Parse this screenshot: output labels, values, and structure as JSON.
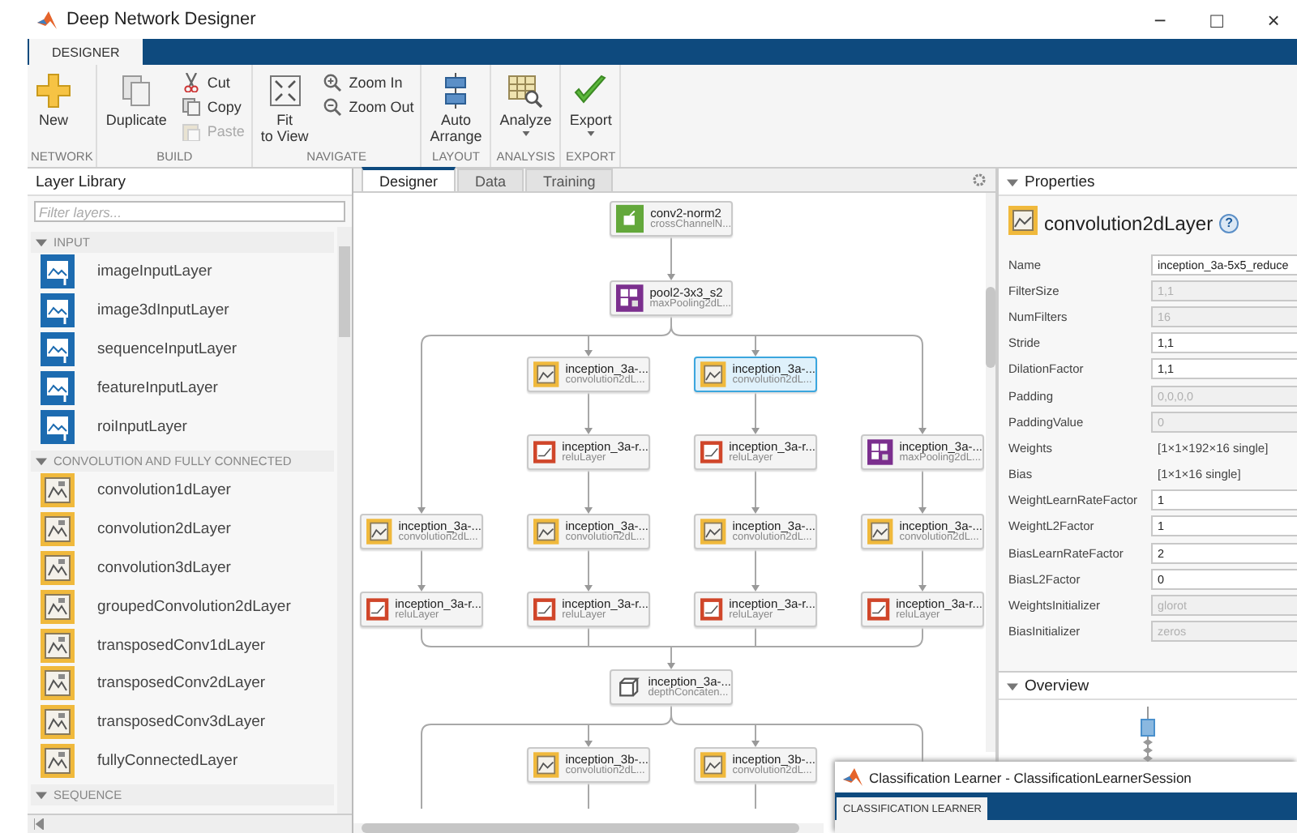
{
  "window": {
    "title": "Deep Network Designer",
    "controls": [
      "−",
      "□",
      "×"
    ]
  },
  "ribbon_tabs": [
    {
      "label": "DESIGNER",
      "selected": true
    }
  ],
  "toolstrip": [
    {
      "label": "NETWORK",
      "items": [
        {
          "kind": "large",
          "label": "New",
          "disabled": false,
          "dropdown": false
        }
      ]
    },
    {
      "label": "BUILD",
      "items": [
        {
          "kind": "large",
          "label": "Duplicate",
          "disabled": false,
          "dropdown": false
        },
        {
          "kind": "small",
          "label": "Cut",
          "disabled": false,
          "dropdown": false
        },
        {
          "kind": "small",
          "label": "Copy",
          "disabled": false,
          "dropdown": false
        },
        {
          "kind": "small",
          "label": "Paste",
          "disabled": true,
          "dropdown": false
        }
      ]
    },
    {
      "label": "NAVIGATE",
      "items": [
        {
          "kind": "large",
          "label": "Fit\nto View",
          "disabled": false,
          "dropdown": false
        },
        {
          "kind": "small",
          "label": "Zoom In",
          "disabled": false,
          "dropdown": false
        },
        {
          "kind": "small",
          "label": "Zoom Out",
          "disabled": false,
          "dropdown": false
        }
      ]
    },
    {
      "label": "LAYOUT",
      "items": [
        {
          "kind": "large",
          "label": "Auto\nArrange",
          "disabled": false,
          "dropdown": false
        }
      ]
    },
    {
      "label": "ANALYSIS",
      "items": [
        {
          "kind": "large",
          "label": "Analyze",
          "disabled": false,
          "dropdown": true
        }
      ]
    },
    {
      "label": "EXPORT",
      "items": [
        {
          "kind": "large",
          "label": "Export",
          "disabled": false,
          "dropdown": true
        }
      ]
    }
  ],
  "layer_library": {
    "title": "Layer Library",
    "filter": {
      "placeholder": "Filter layers..."
    },
    "sections": [
      {
        "title": "INPUT",
        "kind": "input",
        "expanded": true,
        "items": [
          {
            "label": "imageInputLayer"
          },
          {
            "label": "image3dInputLayer"
          },
          {
            "label": "sequenceInputLayer"
          },
          {
            "label": "featureInputLayer"
          },
          {
            "label": "roiInputLayer"
          }
        ]
      },
      {
        "title": "CONVOLUTION AND FULLY CONNECTED",
        "kind": "convolution",
        "expanded": true,
        "items": [
          {
            "label": "convolution1dLayer"
          },
          {
            "label": "convolution2dLayer"
          },
          {
            "label": "convolution3dLayer"
          },
          {
            "label": "groupedConvolution2dLayer"
          },
          {
            "label": "transposedConv1dLayer"
          },
          {
            "label": "transposedConv2dLayer"
          },
          {
            "label": "transposedConv3dLayer"
          },
          {
            "label": "fullyConnectedLayer"
          }
        ]
      },
      {
        "title": "SEQUENCE",
        "expanded": true
      }
    ]
  },
  "canvas": {
    "tabs": [
      {
        "label": "Designer",
        "selected": true
      },
      {
        "label": "Data",
        "selected": false
      },
      {
        "label": "Training",
        "selected": false
      }
    ],
    "rows": [
      [
        {
          "kind": "norm",
          "name": "conv2-norm2",
          "type": "crossChannelN...",
          "selected": false
        }
      ],
      [
        {
          "kind": "pool",
          "name": "pool2-3x3_s2",
          "type": "maxPooling2dL...",
          "selected": false
        }
      ],
      [
        "",
        {
          "kind": "conv",
          "name": "inception_3a-...",
          "type": "convolution2dL...",
          "selected": false
        },
        {
          "kind": "conv",
          "name": "inception_3a-...",
          "type": "convolution2dL...",
          "selected": true
        }
      ],
      [
        "",
        {
          "kind": "relu",
          "name": "inception_3a-r...",
          "type": "reluLayer",
          "selected": false
        },
        {
          "kind": "relu",
          "name": "inception_3a-r...",
          "type": "reluLayer",
          "selected": false
        },
        {
          "kind": "pool",
          "name": "inception_3a-...",
          "type": "maxPooling2dL...",
          "selected": false
        }
      ],
      [
        {
          "kind": "conv",
          "name": "inception_3a-...",
          "type": "convolution2dL...",
          "selected": false
        },
        {
          "kind": "conv",
          "name": "inception_3a-...",
          "type": "convolution2dL...",
          "selected": false
        },
        {
          "kind": "conv",
          "name": "inception_3a-...",
          "type": "convolution2dL...",
          "selected": false
        },
        {
          "kind": "conv",
          "name": "inception_3a-...",
          "type": "convolution2dL...",
          "selected": false
        }
      ],
      [
        {
          "kind": "relu",
          "name": "inception_3a-r...",
          "type": "reluLayer",
          "selected": false
        },
        {
          "kind": "relu",
          "name": "inception_3a-r...",
          "type": "reluLayer",
          "selected": false
        },
        {
          "kind": "relu",
          "name": "inception_3a-r...",
          "type": "reluLayer",
          "selected": false
        },
        {
          "kind": "relu",
          "name": "inception_3a-r...",
          "type": "reluLayer",
          "selected": false
        }
      ],
      [
        {
          "kind": "concat",
          "name": "inception_3a-...",
          "type": "depthConcaten...",
          "selected": false
        }
      ],
      [
        "",
        {
          "kind": "conv",
          "name": "inception_3b-...",
          "type": "convolution2dL...",
          "selected": false
        },
        {
          "kind": "conv",
          "name": "inception_3b-...",
          "type": "convolution2dL...",
          "selected": false
        }
      ]
    ]
  },
  "properties": {
    "title": "Properties",
    "expanded": true,
    "layer": {
      "kind": "conv",
      "title": "convolution2dLayer",
      "help": "?"
    },
    "rows": [
      {
        "label": "Name",
        "value": "inception_3a-5x5_reduce",
        "kind": "field",
        "disabled": false
      },
      {
        "label": "FilterSize",
        "value": "1,1",
        "kind": "field",
        "disabled": true
      },
      {
        "label": "NumFilters",
        "value": "16",
        "kind": "field",
        "disabled": true
      },
      {
        "label": "Stride",
        "value": "1,1",
        "kind": "field",
        "disabled": false
      },
      {
        "label": "DilationFactor",
        "value": "1,1",
        "kind": "field",
        "disabled": false
      },
      {
        "label": "Padding",
        "value": "0,0,0,0",
        "kind": "dropdown",
        "disabled": true
      },
      {
        "label": "PaddingValue",
        "value": "0",
        "kind": "dropdown",
        "disabled": true
      },
      {
        "label": "Weights",
        "value": "[1×1×192×16 single]",
        "kind": "text"
      },
      {
        "label": "Bias",
        "value": "[1×1×16 single]",
        "kind": "text"
      },
      {
        "label": "WeightLearnRateFactor",
        "value": "1",
        "kind": "field",
        "disabled": false
      },
      {
        "label": "WeightL2Factor",
        "value": "1",
        "kind": "field",
        "disabled": false
      },
      {
        "label": "BiasLearnRateFactor",
        "value": "2",
        "kind": "field",
        "disabled": false
      },
      {
        "label": "BiasL2Factor",
        "value": "0",
        "kind": "field",
        "disabled": false
      },
      {
        "label": "WeightsInitializer",
        "value": "glorot",
        "kind": "field",
        "disabled": true
      },
      {
        "label": "BiasInitializer",
        "value": "zeros",
        "kind": "field",
        "disabled": true
      }
    ]
  },
  "overview": {
    "title": "Overview",
    "expanded": true
  },
  "second_window": {
    "title": "Classification Learner - ClassificationLearnerSession",
    "tabs": [
      {
        "label": "CLASSIFICATION LEARNER",
        "selected": true
      }
    ]
  }
}
